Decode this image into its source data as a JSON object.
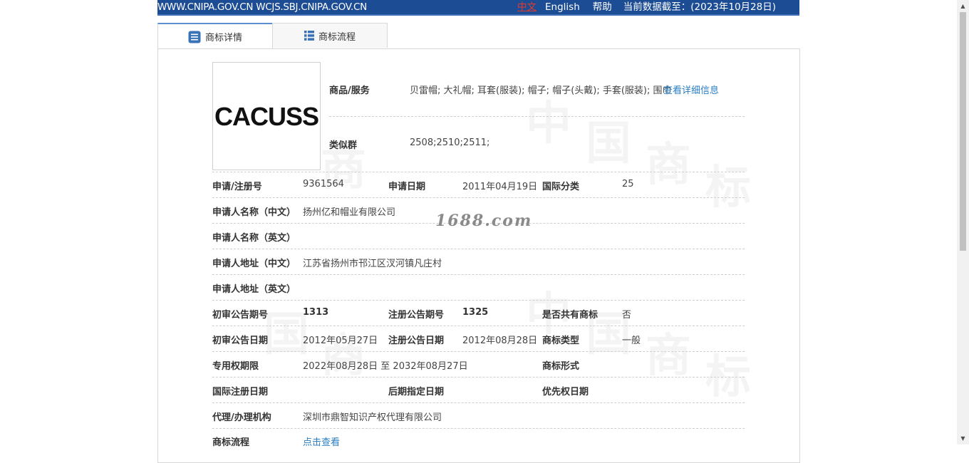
{
  "header": {
    "site": "WWW.CNIPA.GOV.CN WCJS.SBJ.CNIPA.GOV.CN",
    "lang_zh": "中文",
    "lang_en": "English",
    "help": "帮助",
    "data_date": "当前数据截至：(2023年10月28日)"
  },
  "tabs": [
    {
      "label": "商标详情",
      "icon": "document-list-icon",
      "active": true
    },
    {
      "label": "商标流程",
      "icon": "grid-list-icon",
      "active": false
    }
  ],
  "logo": {
    "text": "CACUSS"
  },
  "watermark": {
    "site": "1688.com",
    "chars": [
      "中",
      "国",
      "商",
      "标"
    ]
  },
  "goods": {
    "label": "商品/服务",
    "value": "贝雷帽; 大礼帽; 耳套(服装); 帽子; 帽子(头戴); 手套(服装); 围巾",
    "link": "查看详细信息"
  },
  "similar": {
    "label": "类似群",
    "value": "2508;2510;2511;"
  },
  "rows": {
    "reg_no": {
      "label": "申请/注册号",
      "value": "9361564"
    },
    "app_date": {
      "label": "申请日期",
      "value": "2011年04月19日"
    },
    "intl_class": {
      "label": "国际分类",
      "value": "25"
    },
    "applicant_cn": {
      "label": "申请人名称（中文）",
      "value": "扬州亿和帽业有限公司"
    },
    "applicant_en": {
      "label": "申请人名称（英文）",
      "value": ""
    },
    "address_cn": {
      "label": "申请人地址（中文）",
      "value": "江苏省扬州市邗江区汊河镇凡庄村"
    },
    "address_en": {
      "label": "申请人地址（英文）",
      "value": ""
    },
    "prelim_no": {
      "label": "初审公告期号",
      "value": "1313"
    },
    "reg_notice_no": {
      "label": "注册公告期号",
      "value": "1325"
    },
    "shared": {
      "label": "是否共有商标",
      "value": "否"
    },
    "prelim_date": {
      "label": "初审公告日期",
      "value": "2012年05月27日"
    },
    "reg_notice_date": {
      "label": "注册公告日期",
      "value": "2012年08月28日"
    },
    "mark_type": {
      "label": "商标类型",
      "value": "一般"
    },
    "exclusive": {
      "label": "专用权期限",
      "value": "2022年08月28日 至 2032年08月27日"
    },
    "mark_form": {
      "label": "商标形式",
      "value": ""
    },
    "intl_reg_date": {
      "label": "国际注册日期",
      "value": ""
    },
    "later_desig_date": {
      "label": "后期指定日期",
      "value": ""
    },
    "priority_date": {
      "label": "优先权日期",
      "value": ""
    },
    "agent": {
      "label": "代理/办理机构",
      "value": "深圳市鼎智知识产权代理有限公司"
    },
    "flow": {
      "label": "商标流程",
      "value": "点击查看"
    }
  },
  "colors": {
    "banner": "#1c4c94",
    "link": "#2a7ec4",
    "lang_active": "#e23b2e"
  }
}
